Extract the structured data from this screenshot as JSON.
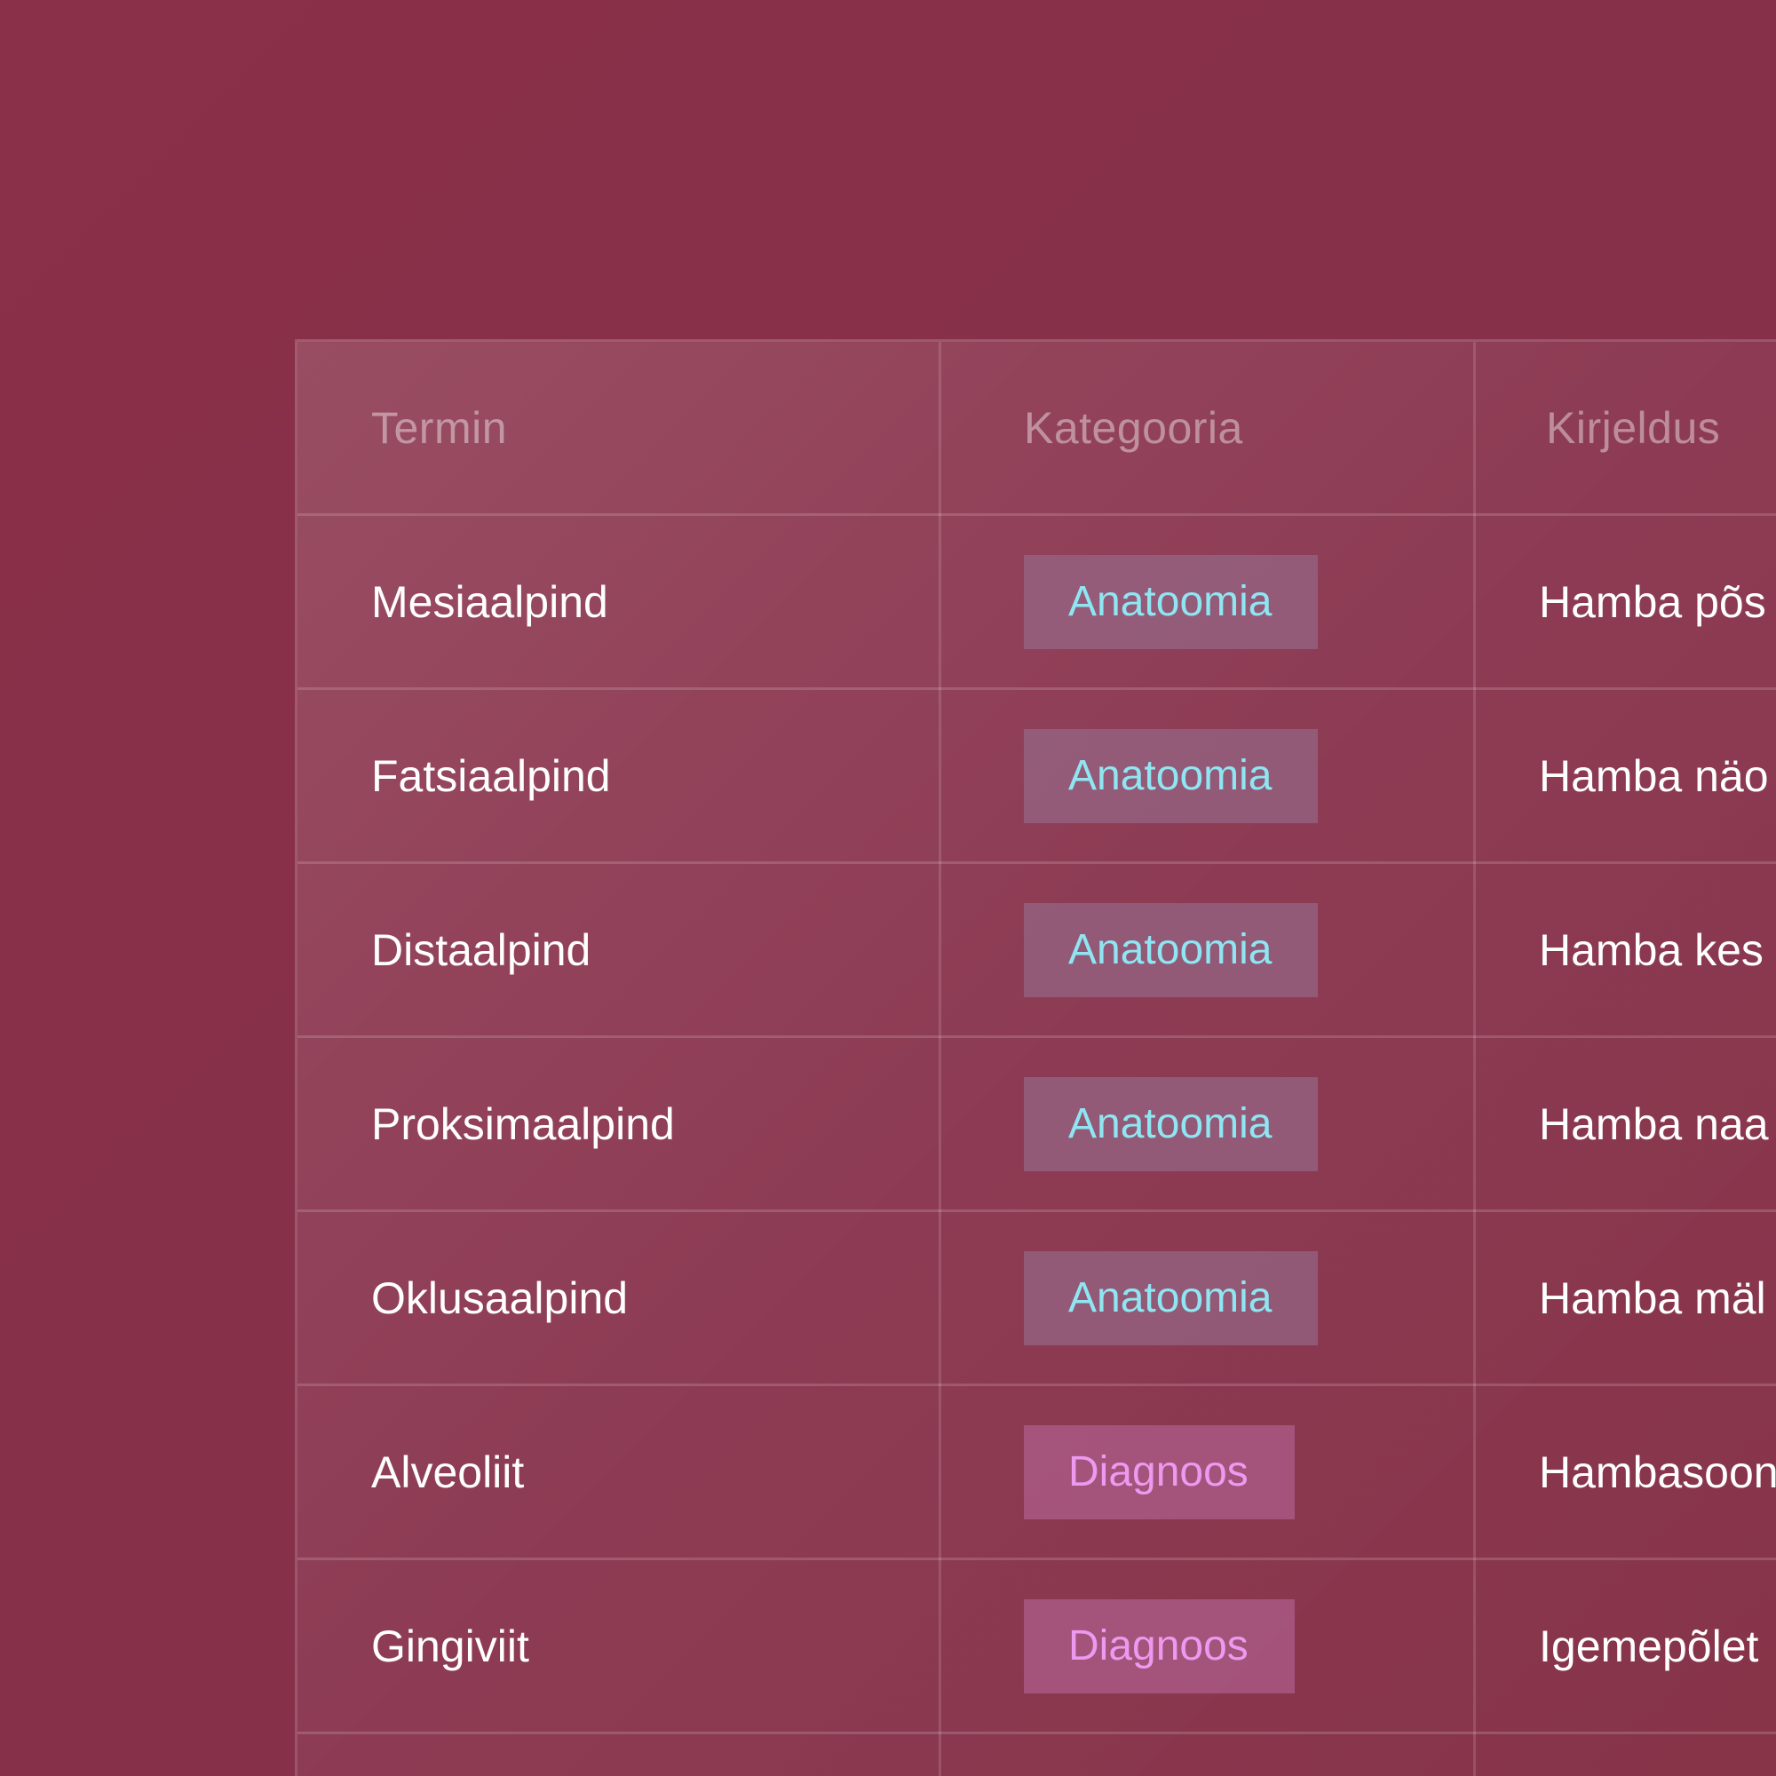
{
  "table": {
    "headers": {
      "term": "Termin",
      "category": "Kategooria",
      "description": "Kirjeldus"
    },
    "rows": [
      {
        "term": "Mesiaalpind",
        "category": "Anatoomia",
        "category_type": "anatomy",
        "description": "Hamba põs"
      },
      {
        "term": "Fatsiaalpind",
        "category": "Anatoomia",
        "category_type": "anatomy",
        "description": "Hamba näo"
      },
      {
        "term": "Distaalpind",
        "category": "Anatoomia",
        "category_type": "anatomy",
        "description": "Hamba kes"
      },
      {
        "term": "Proksimaalpind",
        "category": "Anatoomia",
        "category_type": "anatomy",
        "description": "Hamba naa"
      },
      {
        "term": "Oklusaalpind",
        "category": "Anatoomia",
        "category_type": "anatomy",
        "description": "Hamba mäl"
      },
      {
        "term": "Alveoliit",
        "category": "Diagnoos",
        "category_type": "diagnosis",
        "description": "Hambasoon"
      },
      {
        "term": "Gingiviit",
        "category": "Diagnoos",
        "category_type": "diagnosis",
        "description": "Igemepõlet"
      }
    ]
  },
  "colors": {
    "background": "#852f45",
    "anatomy_badge_text": "#8fe6f2",
    "diagnosis_badge_text": "#ec9af0"
  }
}
